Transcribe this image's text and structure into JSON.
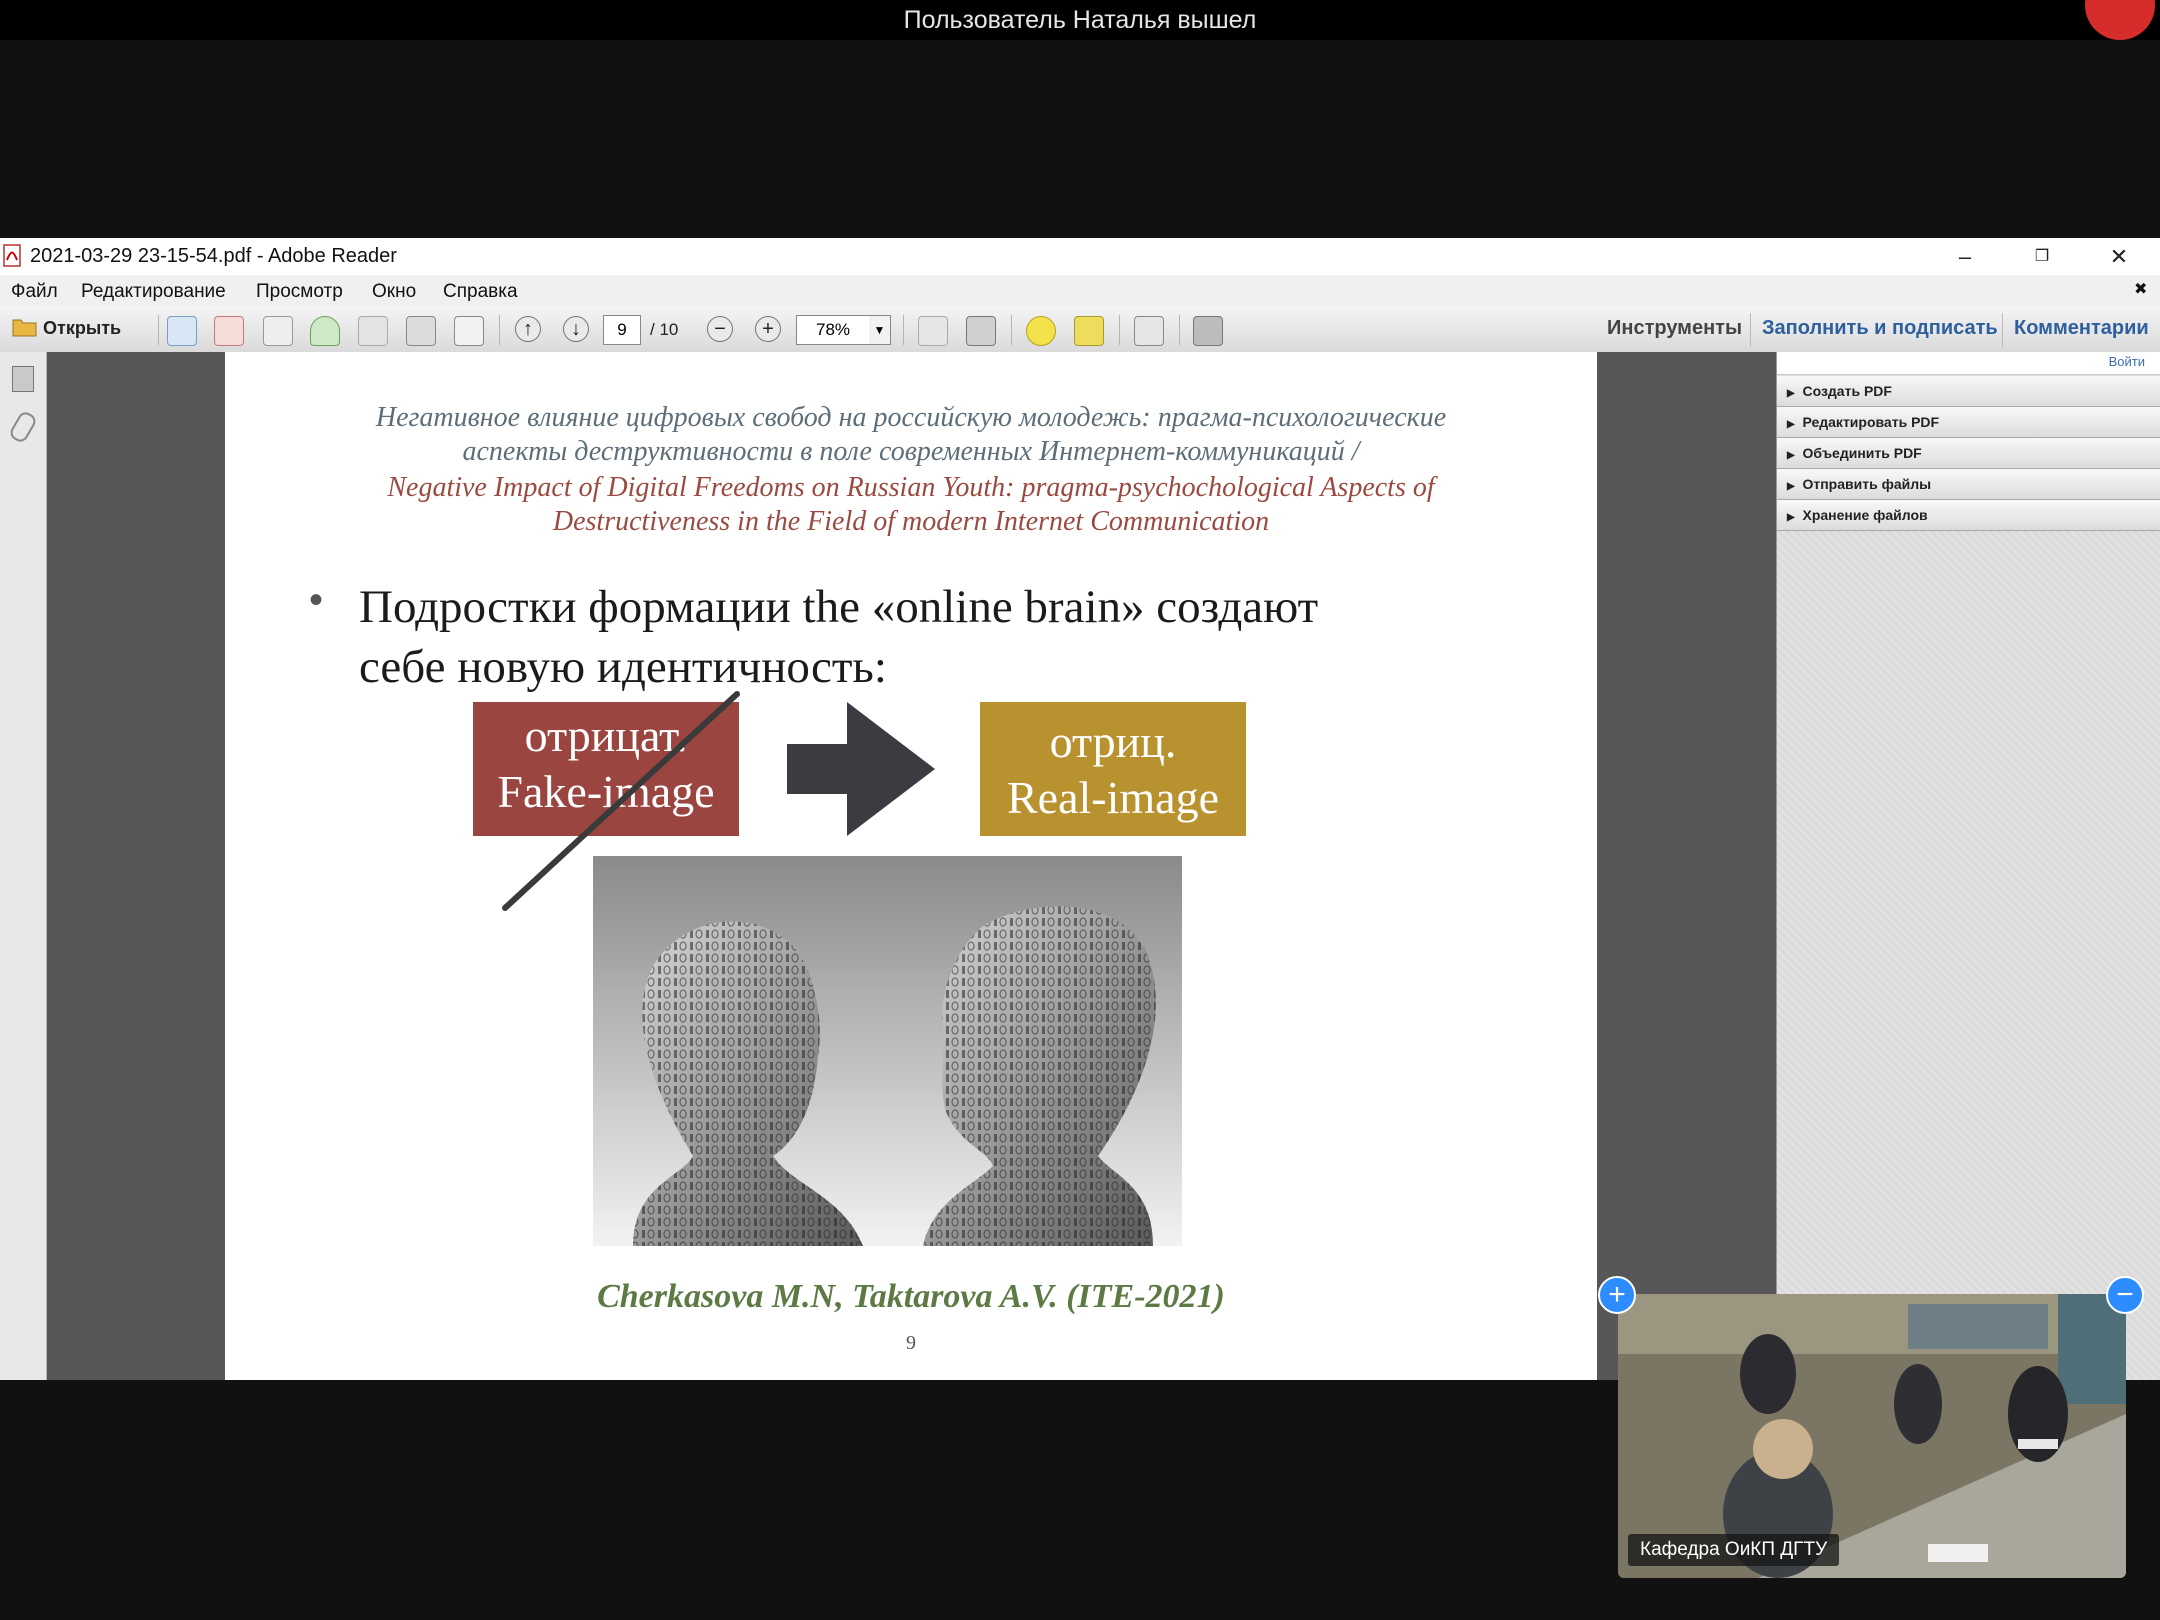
{
  "zoom_banner": {
    "text": "Пользователь Наталья вышел"
  },
  "window": {
    "title": "2021-03-29 23-15-54.pdf - Adobe Reader"
  },
  "menu": [
    "Файл",
    "Редактирование",
    "Просмотр",
    "Окно",
    "Справка"
  ],
  "toolbar": {
    "open_label": "Открыть",
    "page_current": "9",
    "page_total": "/ 10",
    "zoom": "78%",
    "tools_label": "Инструменты",
    "fill_sign_label": "Заполнить и подписать",
    "comments_label": "Комментарии"
  },
  "right_pane": {
    "signin": "Войти",
    "items": [
      "Создать PDF",
      "Редактировать PDF",
      "Объединить PDF",
      "Отправить файлы",
      "Хранение файлов"
    ]
  },
  "slide": {
    "title_ru_1": "Негативное влияние цифровых свобод на российскую молодежь: прагма-психологические",
    "title_ru_2": "аспекты деструктивности в поле современных Интернет-коммуникаций /",
    "title_en_1": "Negative Impact of Digital Freedoms on Russian Youth: pragma-psychochological Aspects of",
    "title_en_2": "Destructiveness in the Field of modern Internet Communication",
    "bullet_1": "Подростки формации the «online brain» создают",
    "bullet_2": "себе новую идентичность:",
    "box_left_1": "отрицат.",
    "box_left_2": "Fake-image",
    "box_right_1": "отриц.",
    "box_right_2": "Real-image",
    "author": "Cherkasova M.N, Taktarova A.V. (ITE-2021)",
    "page_number": "9",
    "colors": {
      "box_left": "#9a4540",
      "box_right": "#b8922f",
      "arrow": "#3d3b41"
    }
  },
  "video": {
    "label": "Кафедра ОиКП ДГТУ"
  }
}
